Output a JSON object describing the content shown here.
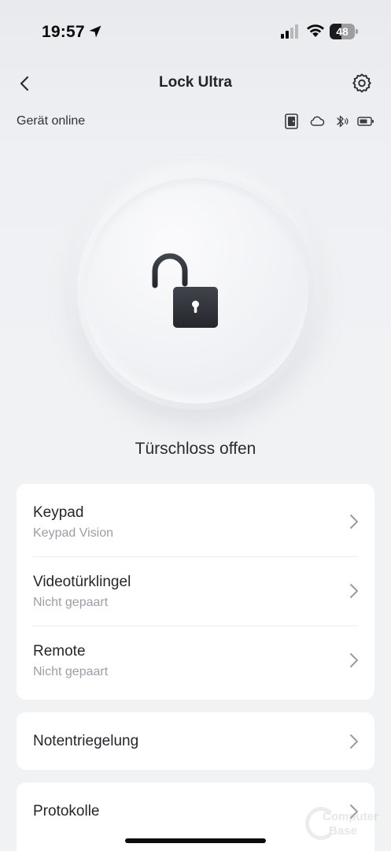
{
  "status_bar": {
    "time": "19:57",
    "battery_percent": "48",
    "battery_level": 0.48
  },
  "nav": {
    "title": "Lock Ultra"
  },
  "device": {
    "status": "Gerät online",
    "icons": [
      "door-icon",
      "cloud-icon",
      "bluetooth-icon",
      "battery-icon"
    ]
  },
  "lock": {
    "status_text": "Türschloss offen",
    "state": "unlocked"
  },
  "accessories": [
    {
      "title": "Keypad",
      "subtitle": "Keypad Vision"
    },
    {
      "title": "Videotürklingel",
      "subtitle": "Nicht gepaart"
    },
    {
      "title": "Remote",
      "subtitle": "Nicht gepaart"
    }
  ],
  "emergency": {
    "title": "Notentriegelung"
  },
  "logs": {
    "title": "Protokolle"
  },
  "watermark": {
    "line1": "Computer",
    "line2": "Base"
  },
  "colors": {
    "background": "#f1f2f4",
    "card": "#ffffff",
    "lock_icon": "#2f3138"
  }
}
